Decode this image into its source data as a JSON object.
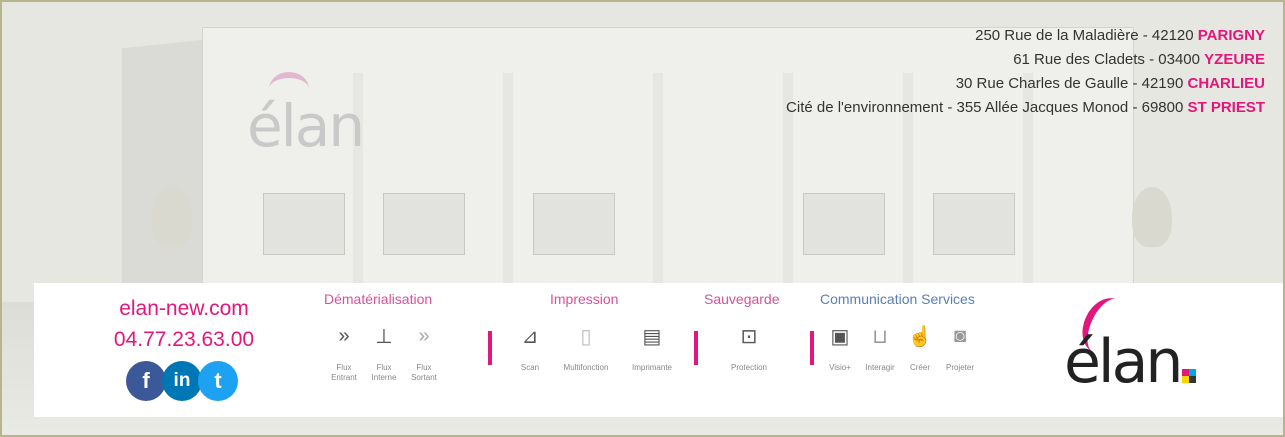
{
  "addresses": [
    {
      "street": "250 Rue de la Maladière - 42120 ",
      "city": "PARIGNY"
    },
    {
      "street": "61 Rue des Cladets - 03400 ",
      "city": "YZEURE"
    },
    {
      "street": "30 Rue Charles de Gaulle - 42190 ",
      "city": "CHARLIEU"
    },
    {
      "street": "Cité de l'environnement - 355 Allée Jacques Monod - 69800 ",
      "city": "ST PRIEST"
    }
  ],
  "contact": {
    "website": "elan-new.com",
    "phone": "04.77.23.63.00"
  },
  "socials": [
    {
      "icon": "facebook-icon",
      "glyph": "f"
    },
    {
      "icon": "linkedin-icon",
      "glyph": "in"
    },
    {
      "icon": "twitter-icon",
      "glyph": "t"
    }
  ],
  "services": {
    "dematerialisation": {
      "title": "Dématérialisation",
      "items": [
        {
          "icon": "double-chevron-icon",
          "glyph": "»",
          "caption": "Flux\nEntrant"
        },
        {
          "icon": "org-chart-icon",
          "glyph": "⊥",
          "caption": "Flux\nInterne"
        },
        {
          "icon": "double-chevron-outline-icon",
          "glyph": "»",
          "caption": "Flux\nSortant"
        }
      ]
    },
    "impression": {
      "title": "Impression",
      "items": [
        {
          "icon": "scanner-icon",
          "glyph": "⊿",
          "caption": "Scan"
        },
        {
          "icon": "multifunction-icon",
          "glyph": "▯",
          "caption": "Multifonction"
        },
        {
          "icon": "printer-icon",
          "glyph": "▤",
          "caption": "Imprimante"
        }
      ]
    },
    "sauvegarde": {
      "title": "Sauvegarde",
      "items": [
        {
          "icon": "padlock-icon",
          "glyph": "⊡",
          "caption": "Protection"
        }
      ]
    },
    "communication": {
      "title": "Communication Services",
      "items": [
        {
          "icon": "monitor-icon",
          "glyph": "▣",
          "caption": "Visio+"
        },
        {
          "icon": "chair-icon",
          "glyph": "⊔",
          "caption": "Interagir"
        },
        {
          "icon": "touch-icon",
          "glyph": "☝",
          "caption": "Créer"
        },
        {
          "icon": "projector-icon",
          "glyph": "◙",
          "caption": "Projeter"
        }
      ]
    }
  },
  "logo": {
    "word": "élan"
  },
  "colors": {
    "accent": "#e2177d",
    "frame": "#b7b58a",
    "group_blue": "#5a7fb0"
  }
}
